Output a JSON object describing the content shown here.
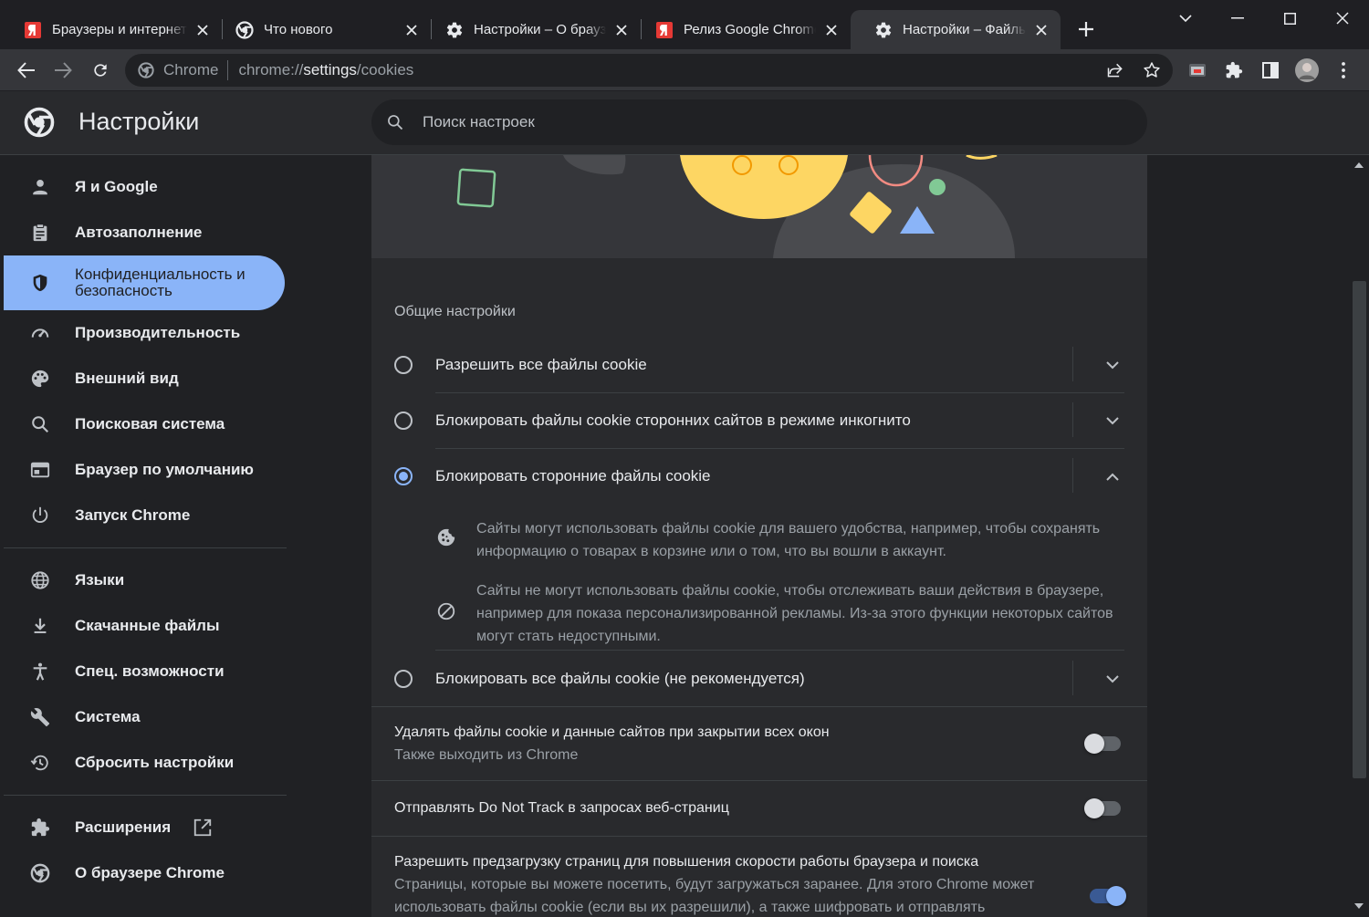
{
  "browser": {
    "tabs": [
      {
        "title": "Браузеры и интернет"
      },
      {
        "title": "Что нового"
      },
      {
        "title": "Настройки – О браузере"
      },
      {
        "title": "Релиз Google Chrome"
      },
      {
        "title": "Настройки – Файлы cookie"
      }
    ],
    "active_tab": 4,
    "site_chip": "Chrome",
    "url": {
      "scheme": "chrome://",
      "host": "settings",
      "path": "/cookies"
    }
  },
  "settings": {
    "title": "Настройки",
    "search_placeholder": "Поиск настроек"
  },
  "sidebar": {
    "items": [
      {
        "label": "Я и Google",
        "icon": "person-icon"
      },
      {
        "label": "Автозаполнение",
        "icon": "clipboard-icon"
      },
      {
        "label": "Конфиденциальность и безопасность",
        "icon": "shield-icon",
        "active": true
      },
      {
        "label": "Производительность",
        "icon": "speedometer-icon"
      },
      {
        "label": "Внешний вид",
        "icon": "palette-icon"
      },
      {
        "label": "Поисковая система",
        "icon": "search-icon"
      },
      {
        "label": "Браузер по умолчанию",
        "icon": "browser-window-icon"
      },
      {
        "label": "Запуск Chrome",
        "icon": "power-icon"
      },
      {
        "label": "Языки",
        "icon": "globe-icon"
      },
      {
        "label": "Скачанные файлы",
        "icon": "download-icon"
      },
      {
        "label": "Спец. возможности",
        "icon": "accessibility-icon"
      },
      {
        "label": "Система",
        "icon": "wrench-icon"
      },
      {
        "label": "Сбросить настройки",
        "icon": "restore-icon"
      },
      {
        "label": "Расширения",
        "icon": "puzzle-icon"
      },
      {
        "label": "О браузере Chrome",
        "icon": "chrome-logo-icon"
      }
    ]
  },
  "cookies": {
    "section_title": "Общие настройки",
    "options": [
      {
        "label": "Разрешить все файлы cookie",
        "checked": false,
        "expanded": false
      },
      {
        "label": "Блокировать файлы cookie сторонних сайтов в режиме инкогнито",
        "checked": false,
        "expanded": false
      },
      {
        "label": "Блокировать сторонние файлы cookie",
        "checked": true,
        "expanded": true
      },
      {
        "label": "Блокировать все файлы cookie (не рекомендуется)",
        "checked": false,
        "expanded": false
      }
    ],
    "details": [
      {
        "icon": "cookie-icon",
        "text": "Сайты могут использовать файлы cookie для вашего удобства, например, чтобы сохранять информацию о товарах в корзине или о том, что вы вошли в аккаунт."
      },
      {
        "icon": "block-icon",
        "text": "Сайты не могут использовать файлы cookie, чтобы отслеживать ваши действия в браузере, например для показа персонализированной рекламы. Из-за этого функции некоторых сайтов могут стать недоступными."
      }
    ],
    "toggles": [
      {
        "primary": "Удалять файлы cookie и данные сайтов при закрытии всех окон",
        "secondary": "Также выходить из Chrome",
        "on": false
      },
      {
        "primary": "Отправлять Do Not Track в запросах веб-страниц",
        "secondary": "",
        "on": false
      },
      {
        "primary": "Разрешить предзагрузку страниц для повышения скорости работы браузера и поиска",
        "secondary": "Страницы, которые вы можете посетить, будут загружаться заранее. Для этого Chrome может использовать файлы cookie (если вы их разрешили), а также шифровать и отправлять",
        "on": true
      }
    ]
  },
  "colors": {
    "accent": "#8ab4f8",
    "background": "#202124",
    "surface": "#292a2d"
  }
}
